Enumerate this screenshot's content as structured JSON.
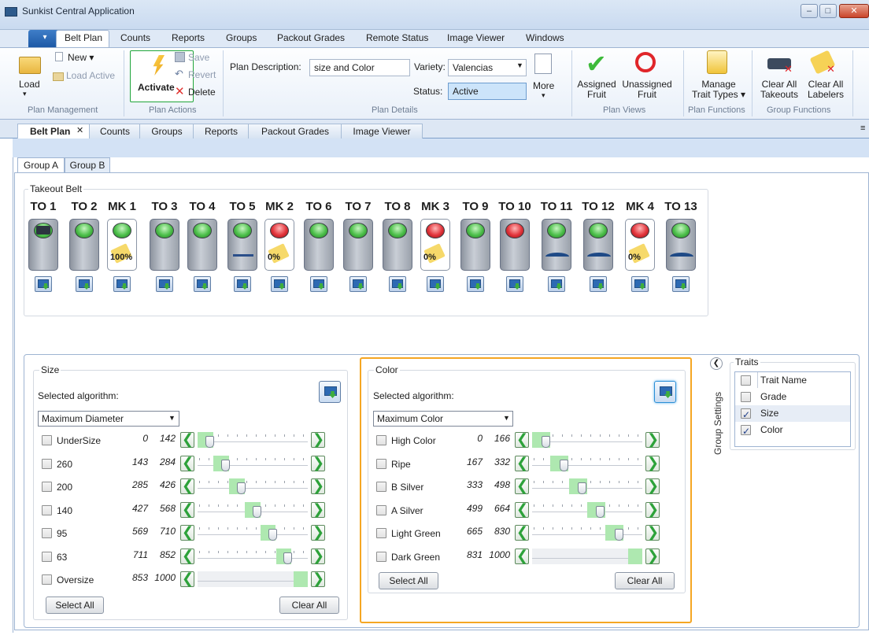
{
  "window": {
    "title": "Sunkist Central Application",
    "controls": [
      "–",
      "□",
      "✕"
    ]
  },
  "ribbon_tabs": [
    {
      "label": "Belt Plan"
    },
    {
      "label": "Counts"
    },
    {
      "label": "Reports"
    },
    {
      "label": "Groups"
    },
    {
      "label": "Packout Grades"
    },
    {
      "label": "Remote Status"
    },
    {
      "label": "Image Viewer"
    },
    {
      "label": "Windows"
    }
  ],
  "file_button": "▾",
  "ribbon": {
    "load": "Load",
    "new": "New ▾",
    "load_active": "Load Active",
    "plan_management": "Plan Management",
    "activate": "Activate",
    "save": "Save",
    "revert": "Revert",
    "delete": "Delete",
    "plan_actions": "Plan Actions",
    "plan_description_label": "Plan Description:",
    "plan_description_value": "size and Color",
    "variety_label": "Variety:",
    "variety_value": "Valencias",
    "status_label": "Status:",
    "status_value": "Active",
    "more": "More",
    "plan_details": "Plan Details",
    "assigned_fruit": "Assigned\nFruit",
    "unassigned_fruit": "Unassigned\nFruit",
    "plan_views": "Plan Views",
    "manage_trait_types": "Manage\nTrait Types ▾",
    "plan_functions": "Plan Functions",
    "clear_all_takeouts": "Clear All\nTakeouts",
    "clear_all_labelers": "Clear All\nLabelers",
    "group_functions": "Group Functions"
  },
  "doc_tabs": [
    {
      "label": "Belt Plan"
    },
    {
      "label": "Counts"
    },
    {
      "label": "Groups"
    },
    {
      "label": "Reports"
    },
    {
      "label": "Packout Grades"
    },
    {
      "label": "Image Viewer"
    }
  ],
  "doc_tab_close": "✕",
  "group_tabs": [
    {
      "label": "Group A"
    },
    {
      "label": "Group B"
    }
  ],
  "takeout_belt": {
    "title": "Takeout Belt",
    "positions": [
      {
        "label": "TO 1",
        "led": "green",
        "icon": "truck-icon"
      },
      {
        "label": "TO 2",
        "led": "green",
        "icon": ""
      },
      {
        "label": "MK 1",
        "led": "green",
        "icon": "label-tag-icon",
        "percent": "100%"
      },
      {
        "label": "TO 3",
        "led": "green",
        "icon": ""
      },
      {
        "label": "TO 4",
        "led": "green",
        "icon": ""
      },
      {
        "label": "TO 5",
        "led": "green",
        "icon": "fork-icon"
      },
      {
        "label": "MK 2",
        "led": "red",
        "icon": "label-tag-icon",
        "percent": "0%"
      },
      {
        "label": "TO 6",
        "led": "green",
        "icon": ""
      },
      {
        "label": "TO 7",
        "led": "green",
        "icon": ""
      },
      {
        "label": "TO 8",
        "led": "green",
        "icon": ""
      },
      {
        "label": "MK 3",
        "led": "red",
        "icon": "label-tag-icon",
        "percent": "0%"
      },
      {
        "label": "TO 9",
        "led": "green",
        "icon": ""
      },
      {
        "label": "TO 10",
        "led": "red",
        "icon": ""
      },
      {
        "label": "TO 11",
        "led": "green",
        "icon": "chute-icon"
      },
      {
        "label": "TO 12",
        "led": "green",
        "icon": "chute-icon"
      },
      {
        "label": "MK 4",
        "led": "red",
        "icon": "label-tag-icon",
        "percent": "0%"
      },
      {
        "label": "TO 13",
        "led": "green",
        "icon": "chute-icon"
      }
    ]
  },
  "size_panel": {
    "title": "Size",
    "selected_algorithm_label": "Selected algorithm:",
    "algorithm": "Maximum Diameter",
    "range_max": 1000,
    "rows": [
      {
        "label": "UnderSize",
        "min": "0",
        "max": "142"
      },
      {
        "label": "260",
        "min": "143",
        "max": "284"
      },
      {
        "label": "200",
        "min": "285",
        "max": "426"
      },
      {
        "label": "140",
        "min": "427",
        "max": "568"
      },
      {
        "label": "95",
        "min": "569",
        "max": "710"
      },
      {
        "label": "63",
        "min": "711",
        "max": "852"
      },
      {
        "label": "Oversize",
        "min": "853",
        "max": "1000"
      }
    ],
    "select_all": "Select All",
    "clear_all": "Clear All"
  },
  "color_panel": {
    "title": "Color",
    "selected_algorithm_label": "Selected algorithm:",
    "algorithm": "Maximum Color",
    "range_max": 1000,
    "rows": [
      {
        "label": "High Color",
        "min": "0",
        "max": "166"
      },
      {
        "label": "Ripe",
        "min": "167",
        "max": "332"
      },
      {
        "label": "B Silver",
        "min": "333",
        "max": "498"
      },
      {
        "label": "A Silver",
        "min": "499",
        "max": "664"
      },
      {
        "label": "Light Green",
        "min": "665",
        "max": "830"
      },
      {
        "label": "Dark Green",
        "min": "831",
        "max": "1000"
      }
    ],
    "select_all": "Select All",
    "clear_all": "Clear All"
  },
  "group_settings": "Group Settings",
  "traits": {
    "title": "Traits",
    "header": "Trait Name",
    "rows": [
      {
        "name": "Grade",
        "checked": false
      },
      {
        "name": "Size",
        "checked": true
      },
      {
        "name": "Color",
        "checked": true
      }
    ]
  },
  "colors": {
    "accent_orange": "#f5a623",
    "active_green": "#1fa53a",
    "range_green": "#aee8b0"
  }
}
